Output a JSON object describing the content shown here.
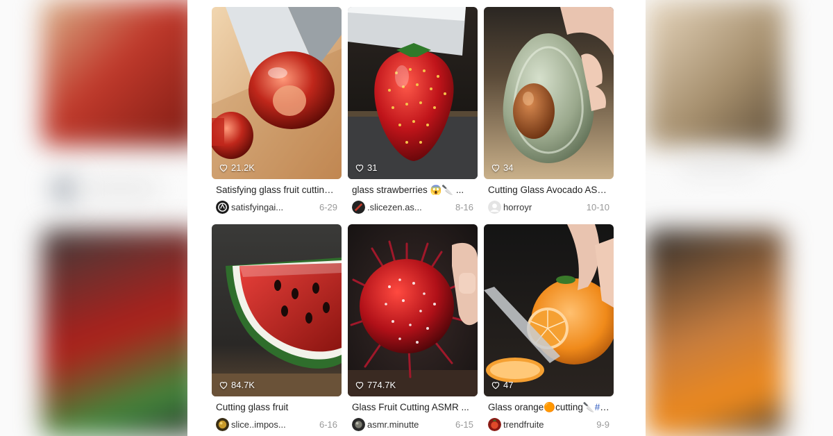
{
  "cards": [
    {
      "title": "Satisfying glass fruit cutting ...",
      "likes": "21.2K",
      "author": "satisfyingai...",
      "date": "6-29",
      "image": "glass-cherry-cut-image",
      "avatar": "ai-logo-avatar"
    },
    {
      "title": "glass strawberries 😱🔪 ...",
      "likes": "31",
      "author": ".slicezen.as...",
      "date": "8-16",
      "image": "glass-strawberry-image",
      "avatar": "slicezen-avatar"
    },
    {
      "title": "Cutting Glass Avocado ASM...",
      "likes": "34",
      "author": "horroyr",
      "date": "10-10",
      "image": "glass-avocado-image",
      "avatar": "default-user-avatar"
    },
    {
      "title": "Cutting glass fruit",
      "likes": "84.7K",
      "author": "slice..impos...",
      "date": "6-16",
      "image": "glass-watermelon-image",
      "avatar": "slice-impos-avatar"
    },
    {
      "title": "Glass Fruit Cutting ASMR ...",
      "likes": "774.7K",
      "author": "asmr.minutte",
      "date": "6-15",
      "image": "glass-rambutan-image",
      "avatar": "asmr-minutte-avatar"
    },
    {
      "title_prefix": "Glass orange🟠cutting🔪",
      "title_hashtag": "#ai",
      "title_suffix": " ...",
      "likes": "47",
      "author": "trendfruite",
      "date": "9-9",
      "image": "glass-orange-image",
      "avatar": "trendfruite-avatar"
    }
  ],
  "colors": {
    "hashtag": "#2f5bbf",
    "date": "#999999",
    "likes_text": "#ffffff"
  },
  "icons": {
    "likes": "heart-outline-icon"
  }
}
